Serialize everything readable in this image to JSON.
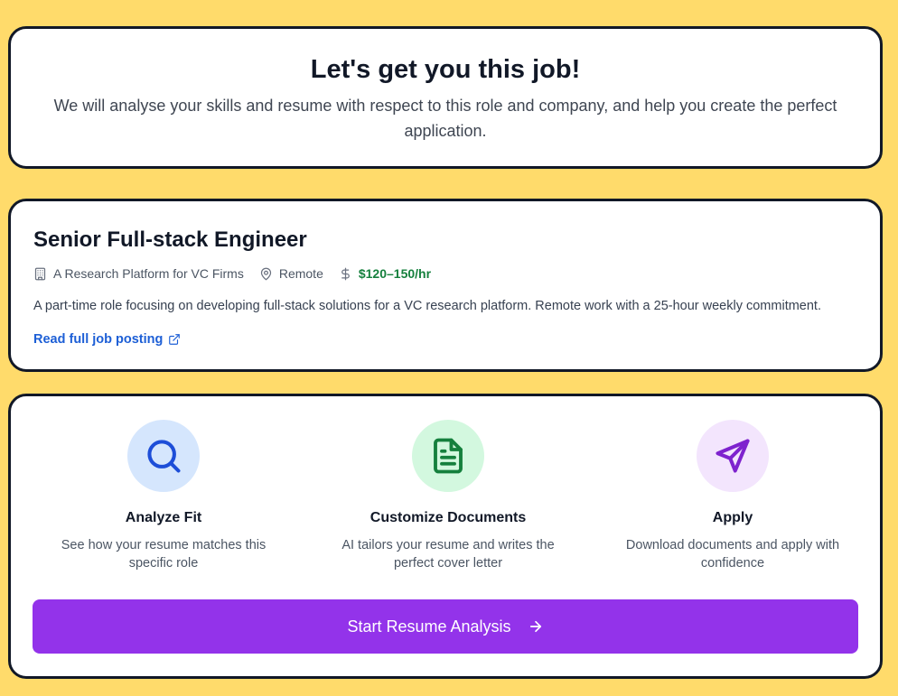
{
  "hero": {
    "title": "Let's get you this job!",
    "subtitle": "We will analyse your skills and resume with respect to this role and company, and help you create the perfect application."
  },
  "job": {
    "title": "Senior Full-stack Engineer",
    "company": "A Research Platform for VC Firms",
    "location": "Remote",
    "salary": "$120–150/hr",
    "description": "A part-time role focusing on developing full-stack solutions for a VC research platform. Remote work with a 25-hour weekly commitment.",
    "link_label": "Read full job posting",
    "icons": [
      "building-icon",
      "map-pin-icon",
      "dollar-icon",
      "external-link-icon"
    ]
  },
  "steps": [
    {
      "title": "Analyze Fit",
      "description": "See how your resume matches this specific role",
      "icon": "search-icon",
      "circle_color": "#d5e6fd",
      "icon_color": "#1d4ed8"
    },
    {
      "title": "Customize Documents",
      "description": "AI tailors your resume and writes the perfect cover letter",
      "icon": "document-icon",
      "circle_color": "#d3f8df",
      "icon_color": "#15803d"
    },
    {
      "title": "Apply",
      "description": "Download documents and apply with confidence",
      "icon": "send-icon",
      "circle_color": "#f3e5fd",
      "icon_color": "#7e22ce"
    }
  ],
  "cta": {
    "label": "Start Resume Analysis",
    "icon": "arrow-right-icon",
    "color": "#9333ea"
  },
  "colors": {
    "background": "#FFDB6B",
    "card_border": "#111827",
    "link": "#1d5fd6",
    "salary": "#15803d"
  }
}
